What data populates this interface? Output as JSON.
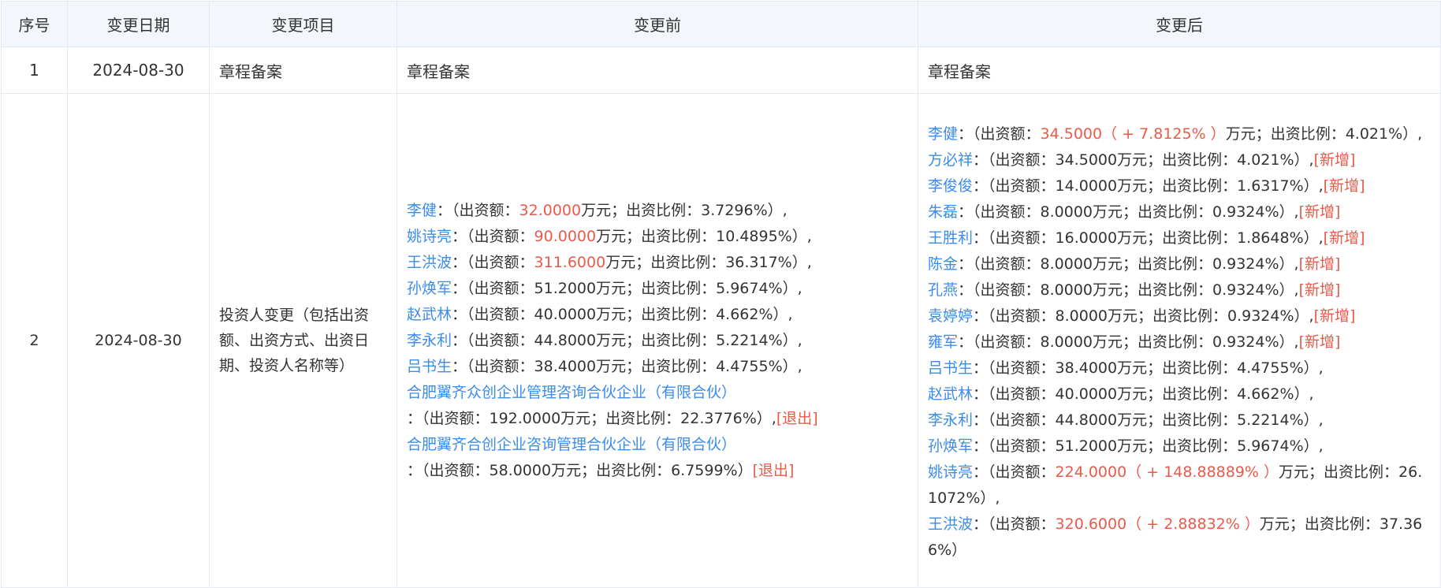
{
  "headers": [
    "序号",
    "变更日期",
    "变更项目",
    "变更前",
    "变更后"
  ],
  "rows": [
    {
      "index": "1",
      "date": "2024-08-30",
      "item": "章程备案",
      "before_text": "章程备案",
      "after_text": "章程备案"
    },
    {
      "index": "2",
      "date": "2024-08-30",
      "item": "投资人变更（包括出资额、出资方式、出资日期、投资人名称等）",
      "before": [
        {
          "name": "李健",
          "pre": "：（出资额：",
          "amount": "32.0000",
          "post": "万元；出资比例：3.7296%）,",
          "tag": ""
        },
        {
          "name": "姚诗亮",
          "pre": "：（出资额：",
          "amount": "90.0000",
          "post": "万元；出资比例：10.4895%）,",
          "tag": ""
        },
        {
          "name": "王洪波",
          "pre": "：（出资额：",
          "amount": "311.6000",
          "post": "万元；出资比例：36.317%）,",
          "tag": ""
        },
        {
          "name": "孙焕军",
          "pre": "：（出资额：51.2000万元；出资比例：5.9674%）,",
          "amount": "",
          "post": "",
          "tag": ""
        },
        {
          "name": "赵武林",
          "pre": "：（出资额：40.0000万元；出资比例：4.662%）,",
          "amount": "",
          "post": "",
          "tag": ""
        },
        {
          "name": "李永利",
          "pre": "：（出资额：44.8000万元；出资比例：5.2214%）,",
          "amount": "",
          "post": "",
          "tag": ""
        },
        {
          "name": "吕书生",
          "pre": "：（出资额：38.4000万元；出资比例：4.4755%）,",
          "amount": "",
          "post": "",
          "tag": ""
        },
        {
          "name": "合肥翼齐众创企业管理咨询合伙企业（有限合伙）",
          "pre": "",
          "amount": "",
          "post": "",
          "tag": ""
        },
        {
          "name": "",
          "pre": "：（出资额：192.0000万元；出资比例：22.3776%）,",
          "amount": "",
          "post": "",
          "tag": "[退出]"
        },
        {
          "name": "合肥翼齐合创企业咨询管理合伙企业（有限合伙）",
          "pre": "",
          "amount": "",
          "post": "",
          "tag": ""
        },
        {
          "name": "",
          "pre": "：（出资额：58.0000万元；出资比例：6.7599%）",
          "amount": "",
          "post": "",
          "tag": "[退出]"
        }
      ],
      "after": [
        {
          "name": "李健",
          "pre": "：（出资额：",
          "amount": "34.5000（ + 7.8125% ）",
          "post": "万元；出资比例：4.021%）,",
          "tag": ""
        },
        {
          "name": "方必祥",
          "pre": "：（出资额：34.5000万元；出资比例：4.021%）,",
          "amount": "",
          "post": "",
          "tag": "[新增]"
        },
        {
          "name": "李俊俊",
          "pre": "：（出资额：14.0000万元；出资比例：1.6317%）,",
          "amount": "",
          "post": "",
          "tag": "[新增]"
        },
        {
          "name": "朱磊",
          "pre": "：（出资额：8.0000万元；出资比例：0.9324%）,",
          "amount": "",
          "post": "",
          "tag": "[新增]"
        },
        {
          "name": "王胜利",
          "pre": "：（出资额：16.0000万元；出资比例：1.8648%）,",
          "amount": "",
          "post": "",
          "tag": "[新增]"
        },
        {
          "name": "陈金",
          "pre": "：（出资额：8.0000万元；出资比例：0.9324%）,",
          "amount": "",
          "post": "",
          "tag": "[新增]"
        },
        {
          "name": "孔燕",
          "pre": "：（出资额：8.0000万元；出资比例：0.9324%）,",
          "amount": "",
          "post": "",
          "tag": "[新增]"
        },
        {
          "name": "袁婷婷",
          "pre": "：（出资额：8.0000万元；出资比例：0.9324%）,",
          "amount": "",
          "post": "",
          "tag": "[新增]"
        },
        {
          "name": "雍军",
          "pre": "：（出资额：8.0000万元；出资比例：0.9324%）,",
          "amount": "",
          "post": "",
          "tag": "[新增]"
        },
        {
          "name": "吕书生",
          "pre": "：（出资额：38.4000万元；出资比例：4.4755%）,",
          "amount": "",
          "post": "",
          "tag": ""
        },
        {
          "name": "赵武林",
          "pre": "：（出资额：40.0000万元；出资比例：4.662%）,",
          "amount": "",
          "post": "",
          "tag": ""
        },
        {
          "name": "李永利",
          "pre": "：（出资额：44.8000万元；出资比例：5.2214%）,",
          "amount": "",
          "post": "",
          "tag": ""
        },
        {
          "name": "孙焕军",
          "pre": "：（出资额：51.2000万元；出资比例：5.9674%）,",
          "amount": "",
          "post": "",
          "tag": ""
        },
        {
          "name": "姚诗亮",
          "pre": "：（出资额：",
          "amount": "224.0000（ + 148.88889% ）",
          "post": "万元；出资比例：26.1072%）,",
          "tag": ""
        },
        {
          "name": "王洪波",
          "pre": "：（出资额：",
          "amount": "320.6000（ + 2.88832% ）",
          "post": "万元；出资比例：37.366%）",
          "tag": ""
        }
      ]
    }
  ]
}
